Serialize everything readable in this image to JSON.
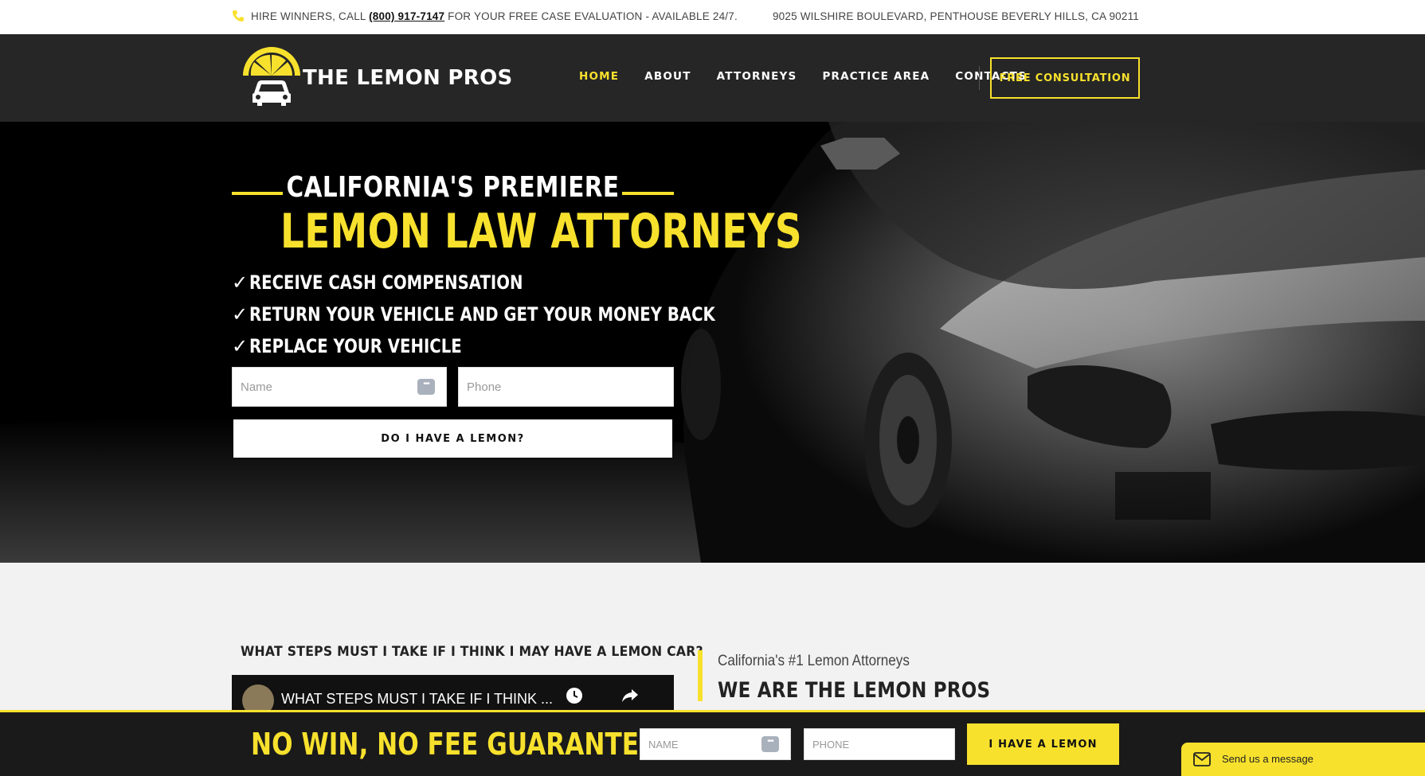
{
  "topbar": {
    "prefix": "HIRE WINNERS, CALL ",
    "phone": "(800) 917-7147",
    "suffix": " FOR YOUR FREE CASE EVALUATION - AVAILABLE 24/7.",
    "address": "9025 WILSHIRE BOULEVARD, PENTHOUSE BEVERLY HILLS, CA 90211"
  },
  "header": {
    "brand": "THE LEMON PROS",
    "nav": [
      "HOME",
      "ABOUT",
      "ATTORNEYS",
      "PRACTICE AREA",
      "CONTACTS"
    ],
    "active": "HOME",
    "cta": "FREE CONSULTATION"
  },
  "hero": {
    "subtitle": "CALIFORNIA'S PREMIERE",
    "title": "LEMON LAW ATTORNEYS",
    "benefits": [
      "RECEIVE CASH COMPENSATION",
      "RETURN YOUR VEHICLE AND GET YOUR MONEY BACK",
      "REPLACE YOUR VEHICLE"
    ],
    "name_placeholder": "Name",
    "phone_placeholder": "Phone",
    "button": "DO I HAVE A LEMON?"
  },
  "content": {
    "question": "WHAT STEPS MUST I TAKE IF I THINK I MAY HAVE A LEMON CAR?",
    "video_title": "WHAT STEPS MUST I TAKE IF I THINK ...",
    "about_sub": "California's #1 Lemon Attorneys",
    "about_title": "WE ARE THE LEMON PROS"
  },
  "bottombar": {
    "guarantee": "NO WIN, NO FEE GUARANTEE.",
    "name_placeholder": "NAME",
    "phone_placeholder": "PHONE",
    "button": "I HAVE A LEMON"
  },
  "chat": {
    "label": "Send us a message"
  },
  "colors": {
    "accent": "#f7e12d",
    "dark": "#262626"
  }
}
